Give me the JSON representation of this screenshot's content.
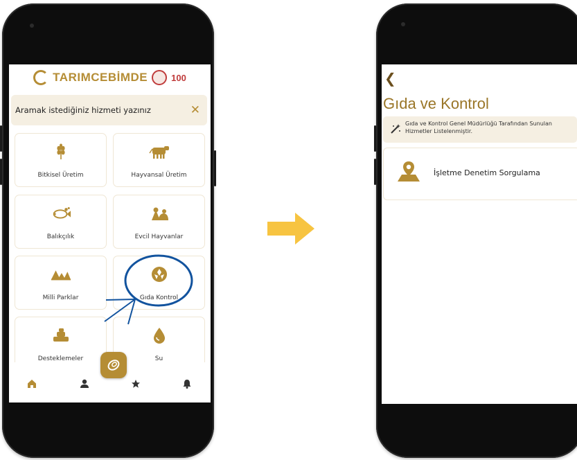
{
  "colors": {
    "gold": "#b58d35",
    "gold_dark": "#9a7628",
    "cream": "#f5efe2",
    "arrow": "#f7c441",
    "annotation_blue": "#12539e"
  },
  "left_screen": {
    "brand": {
      "name": "TARIMCEBİMDE",
      "badge": "100"
    },
    "search": {
      "placeholder": "Aramak istediğiniz hizmeti yazınız",
      "close_icon": "close-icon"
    },
    "tiles": [
      {
        "label": "Bitkisel Üretim",
        "icon": "wheat-icon"
      },
      {
        "label": "Hayvansal Üretim",
        "icon": "cow-icon"
      },
      {
        "label": "Balıkçılık",
        "icon": "fish-icon"
      },
      {
        "label": "Evcil Hayvanlar",
        "icon": "pets-icon"
      },
      {
        "label": "Milli Parklar",
        "icon": "park-icon"
      },
      {
        "label": "Gıda Kontrol",
        "icon": "food-control-icon"
      },
      {
        "label": "Desteklemeler",
        "icon": "coins-icon"
      },
      {
        "label": "Su",
        "icon": "water-drop-icon"
      }
    ],
    "bottom_nav": [
      "home-icon",
      "profile-icon",
      "fab-logo-icon",
      "star-icon",
      "bell-icon"
    ]
  },
  "right_screen": {
    "back_icon": "chevron-left-icon",
    "title": "Gıda ve Kontrol",
    "info": "Gıda ve Kontrol Genel Müdürlüğü Tarafından Sunulan Hizmetler Listelenmiştir.",
    "services": [
      {
        "label": "İşletme Denetim Sorgulama",
        "icon": "map-pin-icon"
      }
    ]
  }
}
